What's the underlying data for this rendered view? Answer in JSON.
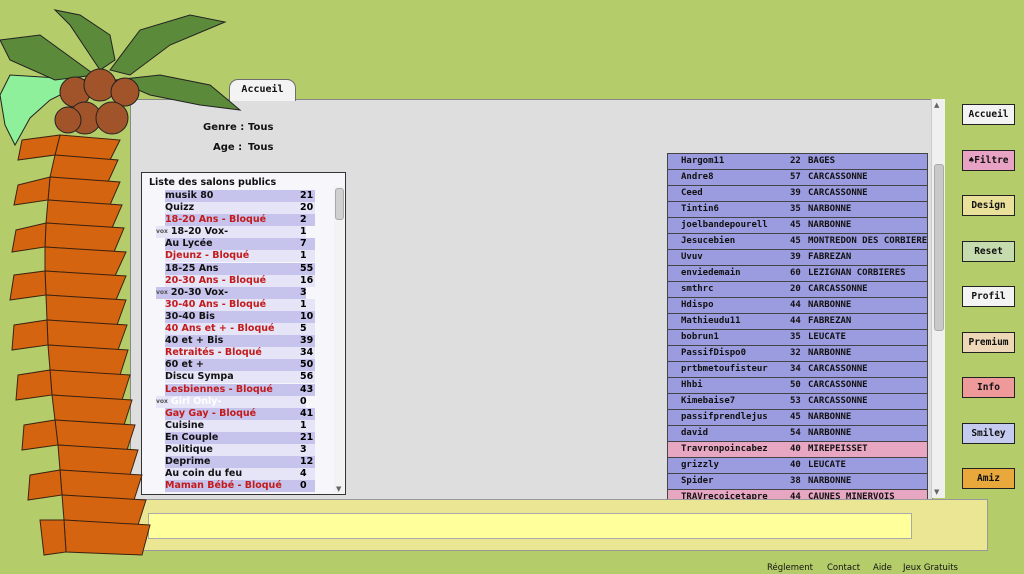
{
  "tab": {
    "label": "Accueil"
  },
  "filters": {
    "genre_label": "Genre :",
    "genre_value": "Tous",
    "age_label": "Age :",
    "age_value": "Tous"
  },
  "salons": {
    "title": "Liste des salons publics",
    "vox_tag": "vox",
    "items": [
      {
        "name": "musik 80",
        "count": "21",
        "blocked": false,
        "vox": false
      },
      {
        "name": "Quizz",
        "count": "20",
        "blocked": false,
        "vox": false
      },
      {
        "name": "18-20 Ans - Bloqué",
        "count": "2",
        "blocked": true,
        "vox": false
      },
      {
        "name": "18-20 Vox-",
        "count": "1",
        "blocked": false,
        "vox": true
      },
      {
        "name": "Au Lycée",
        "count": "7",
        "blocked": false,
        "vox": false
      },
      {
        "name": "Djeunz - Bloqué",
        "count": "1",
        "blocked": true,
        "vox": false
      },
      {
        "name": "18-25 Ans",
        "count": "55",
        "blocked": false,
        "vox": false
      },
      {
        "name": "20-30 Ans - Bloqué",
        "count": "16",
        "blocked": true,
        "vox": false
      },
      {
        "name": "20-30 Vox-",
        "count": "3",
        "blocked": false,
        "vox": true
      },
      {
        "name": "30-40 Ans - Bloqué",
        "count": "1",
        "blocked": true,
        "vox": false
      },
      {
        "name": "30-40 Bis",
        "count": "10",
        "blocked": false,
        "vox": false
      },
      {
        "name": "40 Ans et + - Bloqué",
        "count": "5",
        "blocked": true,
        "vox": false
      },
      {
        "name": "40 et + Bis",
        "count": "39",
        "blocked": false,
        "vox": false
      },
      {
        "name": "Retraités - Bloqué",
        "count": "34",
        "blocked": true,
        "vox": false
      },
      {
        "name": "60 et +",
        "count": "50",
        "blocked": false,
        "vox": false
      },
      {
        "name": "Discu Sympa",
        "count": "56",
        "blocked": false,
        "vox": false
      },
      {
        "name": "Lesbiennes - Bloqué",
        "count": "43",
        "blocked": true,
        "vox": false
      },
      {
        "name": "Girl Only-",
        "count": "0",
        "blocked": false,
        "vox": true,
        "light": true
      },
      {
        "name": "Gay Gay - Bloqué",
        "count": "41",
        "blocked": true,
        "vox": false
      },
      {
        "name": "Cuisine",
        "count": "1",
        "blocked": false,
        "vox": false
      },
      {
        "name": "En Couple",
        "count": "21",
        "blocked": false,
        "vox": false
      },
      {
        "name": "Politique",
        "count": "3",
        "blocked": false,
        "vox": false
      },
      {
        "name": "Deprime",
        "count": "12",
        "blocked": false,
        "vox": false
      },
      {
        "name": "Au coin du feu",
        "count": "4",
        "blocked": false,
        "vox": false
      },
      {
        "name": "Maman Bébé - Bloqué",
        "count": "0",
        "blocked": true,
        "vox": false
      }
    ]
  },
  "users": [
    {
      "name": "Hargom11",
      "age": "22",
      "city": "BAGES",
      "color": "blue"
    },
    {
      "name": "Andre8",
      "age": "57",
      "city": "CARCASSONNE",
      "color": "blue"
    },
    {
      "name": "Ceed",
      "age": "39",
      "city": "CARCASSONNE",
      "color": "blue"
    },
    {
      "name": "Tintin6",
      "age": "35",
      "city": "NARBONNE",
      "color": "blue"
    },
    {
      "name": "joelbandepourell",
      "age": "45",
      "city": "NARBONNE",
      "color": "blue"
    },
    {
      "name": "Jesucebien",
      "age": "45",
      "city": "MONTREDON DES CORBIERES",
      "color": "blue"
    },
    {
      "name": "Uvuv",
      "age": "39",
      "city": "FABREZAN",
      "color": "blue"
    },
    {
      "name": "enviedemain",
      "age": "60",
      "city": "LEZIGNAN CORBIERES",
      "color": "blue"
    },
    {
      "name": "smthrc",
      "age": "20",
      "city": "CARCASSONNE",
      "color": "blue"
    },
    {
      "name": "Hdispo",
      "age": "44",
      "city": "NARBONNE",
      "color": "blue"
    },
    {
      "name": "Mathieudu11",
      "age": "44",
      "city": "FABREZAN",
      "color": "blue"
    },
    {
      "name": "bobrun1",
      "age": "35",
      "city": "LEUCATE",
      "color": "blue"
    },
    {
      "name": "PassifDispo0",
      "age": "32",
      "city": "NARBONNE",
      "color": "blue"
    },
    {
      "name": "prtbmetoufisteur",
      "age": "34",
      "city": "CARCASSONNE",
      "color": "blue"
    },
    {
      "name": "Hhbi",
      "age": "50",
      "city": "CARCASSONNE",
      "color": "blue"
    },
    {
      "name": "Kimebaise7",
      "age": "53",
      "city": "CARCASSONNE",
      "color": "blue"
    },
    {
      "name": "passifprendlejus",
      "age": "45",
      "city": "NARBONNE",
      "color": "blue"
    },
    {
      "name": "david",
      "age": "54",
      "city": "NARBONNE",
      "color": "blue"
    },
    {
      "name": "Travronpoincabez",
      "age": "40",
      "city": "MIREPEISSET",
      "color": "pink"
    },
    {
      "name": "grizzly",
      "age": "40",
      "city": "LEUCATE",
      "color": "blue"
    },
    {
      "name": "Spider",
      "age": "38",
      "city": "NARBONNE",
      "color": "blue"
    },
    {
      "name": "TRAVrecoicetapre",
      "age": "44",
      "city": "CAUNES MINERVOIS",
      "color": "pink"
    }
  ],
  "side_buttons": [
    {
      "label": "Accueil",
      "bg": "#f3f3f3"
    },
    {
      "label": "♠Filtre",
      "bg": "#e8a3c4"
    },
    {
      "label": "Design",
      "bg": "#e9e19a"
    },
    {
      "label": "Reset",
      "bg": "#c6dcae"
    },
    {
      "label": "Profil",
      "bg": "#f3f3f3"
    },
    {
      "label": "Premium",
      "bg": "#eed7b6"
    },
    {
      "label": "Info",
      "bg": "#ef9a9a"
    },
    {
      "label": "Smiley",
      "bg": "#c5cbef"
    },
    {
      "label": "Amiz",
      "bg": "#e8a83c"
    }
  ],
  "message_input": {
    "value": "",
    "placeholder": ""
  },
  "footer": {
    "reglement": "Réglement",
    "contact": "Contact",
    "aide": "Aide",
    "jeux": "Jeux Gratuits"
  },
  "colors": {
    "background": "#b4cc6a",
    "blocked_text": "#c31a1a",
    "user_row_blue": "#9b9be0",
    "user_row_pink": "#e7a6c2"
  }
}
